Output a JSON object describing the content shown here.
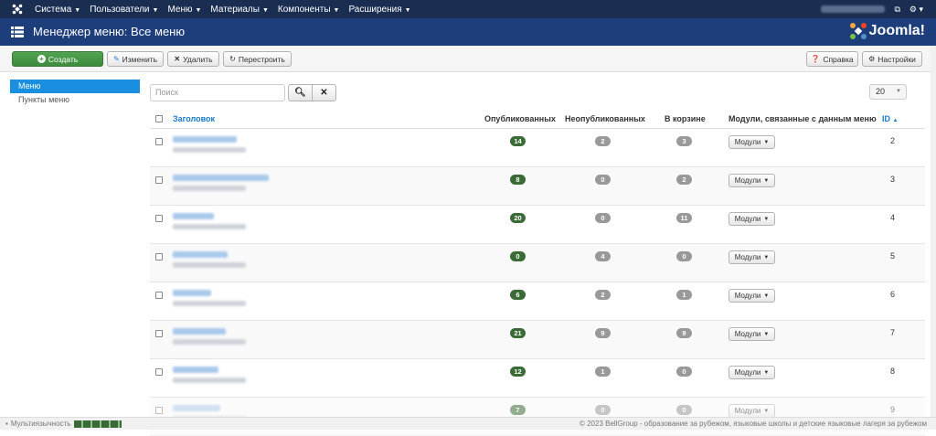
{
  "navbar": {
    "items": [
      {
        "label": "Система"
      },
      {
        "label": "Пользователи"
      },
      {
        "label": "Меню"
      },
      {
        "label": "Материалы"
      },
      {
        "label": "Компоненты"
      },
      {
        "label": "Расширения"
      }
    ],
    "icons": [
      "joomla-logo-icon",
      "external-link-icon",
      "gear-icon"
    ]
  },
  "header": {
    "title": "Менеджер меню: Все меню",
    "brand": "Joomla!"
  },
  "toolbar": {
    "create": "Создать",
    "edit": "Изменить",
    "delete": "Удалить",
    "rebuild": "Перестроить",
    "help": "Справка",
    "options": "Настройки"
  },
  "sidebar": {
    "items": [
      {
        "label": "Меню",
        "active": true
      },
      {
        "label": "Пункты меню",
        "active": false
      }
    ]
  },
  "filter": {
    "search_placeholder": "Поиск",
    "limit": "20"
  },
  "table": {
    "headers": {
      "title": "Заголовок",
      "published": "Опубликованных",
      "unpublished": "Неопубликованных",
      "trashed": "В корзине",
      "modules": "Модули, связанные с данным меню",
      "id": "ID",
      "id_sort": "▲"
    },
    "modules_label": "Модули",
    "rows": [
      {
        "published": "14",
        "unpublished": "2",
        "trashed": "3",
        "id": "2"
      },
      {
        "published": "8",
        "unpublished": "0",
        "trashed": "2",
        "id": "3"
      },
      {
        "published": "20",
        "unpublished": "0",
        "trashed": "11",
        "id": "4"
      },
      {
        "published": "0",
        "unpublished": "4",
        "trashed": "0",
        "id": "5"
      },
      {
        "published": "6",
        "unpublished": "2",
        "trashed": "1",
        "id": "6"
      },
      {
        "published": "21",
        "unpublished": "9",
        "trashed": "9",
        "id": "7"
      },
      {
        "published": "12",
        "unpublished": "1",
        "trashed": "0",
        "id": "8"
      },
      {
        "published": "7",
        "unpublished": "0",
        "trashed": "0",
        "id": "9"
      }
    ]
  },
  "footer": {
    "multilang": "Мультиязычность",
    "copyright": "© 2023 BellGroup - образование за рубежом, языковые школы и детские языковые лагеря за рубежом"
  },
  "colors": {
    "navbar": "#1a2e52",
    "header": "#1e3e7b",
    "create_button": "#46a046",
    "active_sidebar": "#1a8fdf",
    "published_badge": "#3a6b36",
    "neutral_badge": "#999999",
    "link": "#1a7ac7"
  }
}
